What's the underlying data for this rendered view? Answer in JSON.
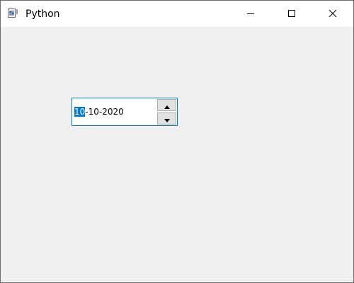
{
  "window": {
    "title": "Python",
    "icon": "python-app-icon",
    "controls": {
      "minimize_icon": "minimize-icon",
      "maximize_icon": "maximize-icon",
      "close_icon": "close-icon"
    }
  },
  "date_edit": {
    "selected_section": "10",
    "rest": "-10-2020",
    "up_icon": "arrow-up-icon",
    "down_icon": "arrow-down-icon"
  },
  "colors": {
    "accent": "#0078d7",
    "client_bg": "#f0f0f0",
    "titlebar_bg": "#ffffff"
  }
}
